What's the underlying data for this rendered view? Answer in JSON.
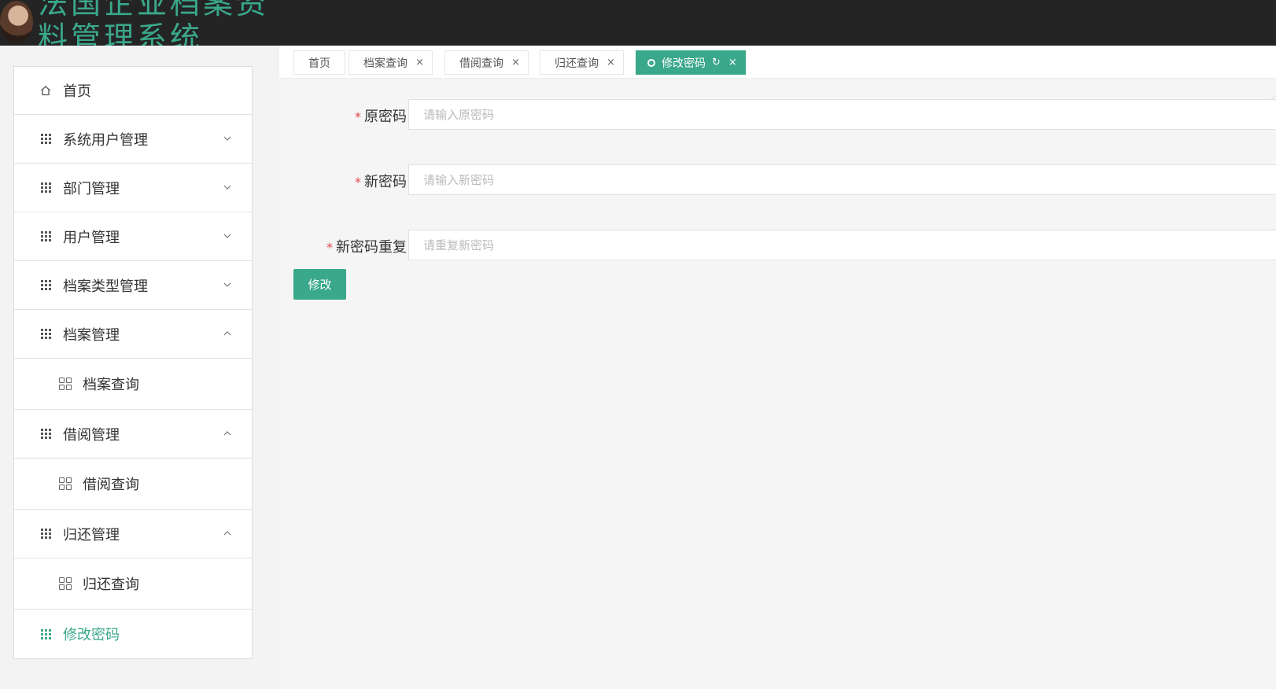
{
  "header": {
    "title": "法国企业档案资料管理系统"
  },
  "sidebar": {
    "items": [
      {
        "label": "首页",
        "icon": "home-icon"
      },
      {
        "label": "系统用户管理",
        "icon": "grid-icon",
        "chevron": "down"
      },
      {
        "label": "部门管理",
        "icon": "grid-icon",
        "chevron": "down"
      },
      {
        "label": "用户管理",
        "icon": "grid-icon",
        "chevron": "down"
      },
      {
        "label": "档案类型管理",
        "icon": "grid-icon",
        "chevron": "down"
      },
      {
        "label": "档案管理",
        "icon": "grid-icon",
        "chevron": "up",
        "sub": "档案查询"
      },
      {
        "label": "借阅管理",
        "icon": "grid-icon",
        "chevron": "up",
        "sub": "借阅查询"
      },
      {
        "label": "归还管理",
        "icon": "grid-icon",
        "chevron": "up",
        "sub": "归还查询"
      },
      {
        "label": "修改密码",
        "icon": "grid-icon",
        "active": true
      }
    ]
  },
  "tabs": [
    {
      "label": "首页"
    },
    {
      "label": "档案查询",
      "close": "×"
    },
    {
      "label": "借阅查询",
      "close": "×"
    },
    {
      "label": "归还查询",
      "close": "×"
    },
    {
      "label": "修改密码",
      "close": "×",
      "refresh": "↻",
      "active": true
    }
  ],
  "form": {
    "fields": [
      {
        "label": "原密码",
        "placeholder": "请输入原密码",
        "value": ""
      },
      {
        "label": "新密码",
        "placeholder": "请输入新密码",
        "value": ""
      },
      {
        "label": "新密码重复",
        "placeholder": "请重复新密码",
        "value": ""
      }
    ],
    "required_mark": "*",
    "submit_label": "修改"
  },
  "colors": {
    "accent": "#3aa88a",
    "header_bg": "#242424",
    "required": "#e04848"
  }
}
